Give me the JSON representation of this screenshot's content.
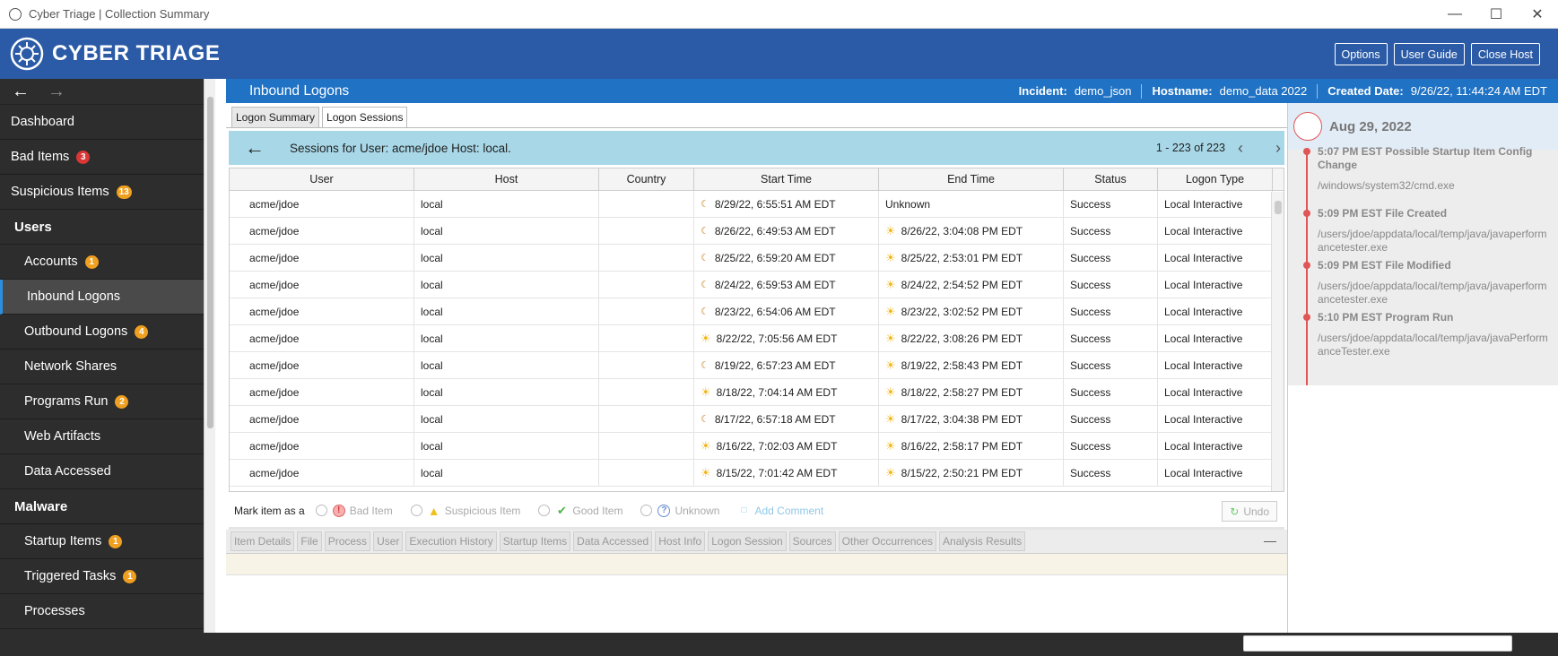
{
  "window": {
    "title": "Cyber Triage | Collection Summary"
  },
  "header": {
    "brand": "CYBER TRIAGE",
    "buttons": [
      "Options",
      "User Guide",
      "Close Host"
    ]
  },
  "sidebar": {
    "items": [
      {
        "label": "Dashboard",
        "kind": "top",
        "badge": null
      },
      {
        "label": "Bad Items",
        "kind": "top",
        "badge": "3",
        "badge_color": "#d93636"
      },
      {
        "label": "Suspicious Items",
        "kind": "top",
        "badge": "13",
        "badge_color": "#f0a020"
      },
      {
        "label": "Users",
        "kind": "section",
        "badge": null
      },
      {
        "label": "Accounts",
        "kind": "sub",
        "badge": "1",
        "badge_color": "#f0a020"
      },
      {
        "label": "Inbound Logons",
        "kind": "sub",
        "active": true,
        "badge": null
      },
      {
        "label": "Outbound Logons",
        "kind": "sub",
        "badge": "4",
        "badge_color": "#f0a020"
      },
      {
        "label": "Network Shares",
        "kind": "sub",
        "badge": null
      },
      {
        "label": "Programs Run",
        "kind": "sub",
        "badge": "2",
        "badge_color": "#f0a020"
      },
      {
        "label": "Web Artifacts",
        "kind": "sub",
        "badge": null
      },
      {
        "label": "Data Accessed",
        "kind": "sub",
        "badge": null
      },
      {
        "label": "Malware",
        "kind": "section",
        "badge": null
      },
      {
        "label": "Startup Items",
        "kind": "sub",
        "badge": "1",
        "badge_color": "#f0a020"
      },
      {
        "label": "Triggered Tasks",
        "kind": "sub",
        "badge": "1",
        "badge_color": "#f0a020"
      },
      {
        "label": "Processes",
        "kind": "sub",
        "badge": null
      }
    ]
  },
  "main": {
    "page_title": "Inbound Logons",
    "meta": {
      "incident_label": "Incident:",
      "incident": "demo_json",
      "hostname_label": "Hostname:",
      "hostname": "demo_data 2022",
      "created_label": "Created Date:",
      "created": "9/26/22, 11:44:24 AM EDT"
    },
    "tabs": [
      "Logon Summary",
      "Logon Sessions"
    ],
    "active_tab": "Logon Sessions",
    "session_title": "Sessions for User: acme/jdoe Host: local.",
    "pagination": "1 - 223 of 223",
    "columns": [
      "User",
      "Host",
      "Country",
      "Start Time",
      "End Time",
      "Status",
      "Logon Type"
    ],
    "rows": [
      {
        "user": "acme/jdoe",
        "host": "local",
        "country": "",
        "start_icon": "moon",
        "start": "8/29/22, 6:55:51 AM EDT",
        "end_icon": "",
        "end": "Unknown",
        "status": "Success",
        "type": "Local Interactive"
      },
      {
        "user": "acme/jdoe",
        "host": "local",
        "country": "",
        "start_icon": "moon",
        "start": "8/26/22, 6:49:53 AM EDT",
        "end_icon": "sun",
        "end": "8/26/22, 3:04:08 PM EDT",
        "status": "Success",
        "type": "Local Interactive"
      },
      {
        "user": "acme/jdoe",
        "host": "local",
        "country": "",
        "start_icon": "moon",
        "start": "8/25/22, 6:59:20 AM EDT",
        "end_icon": "sun",
        "end": "8/25/22, 2:53:01 PM EDT",
        "status": "Success",
        "type": "Local Interactive"
      },
      {
        "user": "acme/jdoe",
        "host": "local",
        "country": "",
        "start_icon": "moon",
        "start": "8/24/22, 6:59:53 AM EDT",
        "end_icon": "sun",
        "end": "8/24/22, 2:54:52 PM EDT",
        "status": "Success",
        "type": "Local Interactive"
      },
      {
        "user": "acme/jdoe",
        "host": "local",
        "country": "",
        "start_icon": "moon",
        "start": "8/23/22, 6:54:06 AM EDT",
        "end_icon": "sun",
        "end": "8/23/22, 3:02:52 PM EDT",
        "status": "Success",
        "type": "Local Interactive"
      },
      {
        "user": "acme/jdoe",
        "host": "local",
        "country": "",
        "start_icon": "sun",
        "start": "8/22/22, 7:05:56 AM EDT",
        "end_icon": "sun",
        "end": "8/22/22, 3:08:26 PM EDT",
        "status": "Success",
        "type": "Local Interactive"
      },
      {
        "user": "acme/jdoe",
        "host": "local",
        "country": "",
        "start_icon": "moon",
        "start": "8/19/22, 6:57:23 AM EDT",
        "end_icon": "sun",
        "end": "8/19/22, 2:58:43 PM EDT",
        "status": "Success",
        "type": "Local Interactive"
      },
      {
        "user": "acme/jdoe",
        "host": "local",
        "country": "",
        "start_icon": "sun",
        "start": "8/18/22, 7:04:14 AM EDT",
        "end_icon": "sun",
        "end": "8/18/22, 2:58:27 PM EDT",
        "status": "Success",
        "type": "Local Interactive"
      },
      {
        "user": "acme/jdoe",
        "host": "local",
        "country": "",
        "start_icon": "moon",
        "start": "8/17/22, 6:57:18 AM EDT",
        "end_icon": "sun",
        "end": "8/17/22, 3:04:38 PM EDT",
        "status": "Success",
        "type": "Local Interactive"
      },
      {
        "user": "acme/jdoe",
        "host": "local",
        "country": "",
        "start_icon": "sun",
        "start": "8/16/22, 7:02:03 AM EDT",
        "end_icon": "sun",
        "end": "8/16/22, 2:58:17 PM EDT",
        "status": "Success",
        "type": "Local Interactive"
      },
      {
        "user": "acme/jdoe",
        "host": "local",
        "country": "",
        "start_icon": "sun",
        "start": "8/15/22, 7:01:42 AM EDT",
        "end_icon": "sun",
        "end": "8/15/22, 2:50:21 PM EDT",
        "status": "Success",
        "type": "Local Interactive"
      }
    ],
    "mark": {
      "label": "Mark item as a",
      "options": [
        "Bad Item",
        "Suspicious Item",
        "Good Item",
        "Unknown"
      ],
      "add_comment": "Add Comment",
      "undo": "Undo"
    },
    "detail_tabs": [
      "Item Details",
      "File",
      "Process",
      "User",
      "Execution History",
      "Startup Items",
      "Data Accessed",
      "Host Info",
      "Logon Session",
      "Sources",
      "Other Occurrences",
      "Analysis Results"
    ]
  },
  "timeline": {
    "date": "Aug 29, 2022",
    "events": [
      {
        "title": "5:07 PM EST Possible Startup Item Config Change",
        "path": "/windows/system32/cmd.exe"
      },
      {
        "title": "5:09 PM EST File Created",
        "path": "/users/jdoe/appdata/local/temp/java/javaperformancetester.exe"
      },
      {
        "title": "5:09 PM EST File Modified",
        "path": "/users/jdoe/appdata/local/temp/java/javaperformancetester.exe"
      },
      {
        "title": "5:10 PM EST Program Run",
        "path": "/users/jdoe/appdata/local/temp/java/javaPerformanceTester.exe"
      }
    ]
  },
  "colors": {
    "header": "#2b5ba6",
    "topbar": "#1f72c4",
    "sidebar": "#2d2d2d",
    "session_bar": "#a8d8e8",
    "timeline_accent": "#e05555"
  }
}
